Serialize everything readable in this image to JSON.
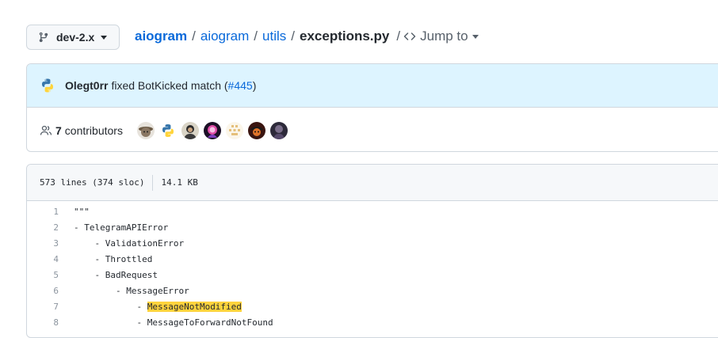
{
  "branch": {
    "label": "dev-2.x"
  },
  "breadcrumb": {
    "owner": "aiogram",
    "sep1": "/",
    "dir1": "aiogram",
    "sep2": "/",
    "dir2": "utils",
    "sep3": "/",
    "file": "exceptions.py",
    "sep4": "/",
    "jump": "Jump to"
  },
  "commit": {
    "author": "Olegt0rr",
    "message": "fixed BotKicked match (",
    "issue": "#445",
    "close": ")"
  },
  "contributors": {
    "count": "7",
    "label": "contributors"
  },
  "file_info": {
    "lines": "573 lines (374 sloc)",
    "size": "14.1 KB"
  },
  "code": {
    "lines": [
      {
        "num": "1",
        "text": "\"\"\""
      },
      {
        "num": "2",
        "text": "- TelegramAPIError"
      },
      {
        "num": "3",
        "text": "    - ValidationError"
      },
      {
        "num": "4",
        "text": "    - Throttled"
      },
      {
        "num": "5",
        "text": "    - BadRequest"
      },
      {
        "num": "6",
        "text": "        - MessageError"
      },
      {
        "num": "7",
        "prefix": "            - ",
        "highlight": "MessageNotModified"
      },
      {
        "num": "8",
        "text": "            - MessageToForwardNotFound"
      }
    ]
  },
  "colors": {
    "link": "#0969da",
    "commit_bg": "#ddf4ff",
    "highlight": "#ffd33d"
  }
}
